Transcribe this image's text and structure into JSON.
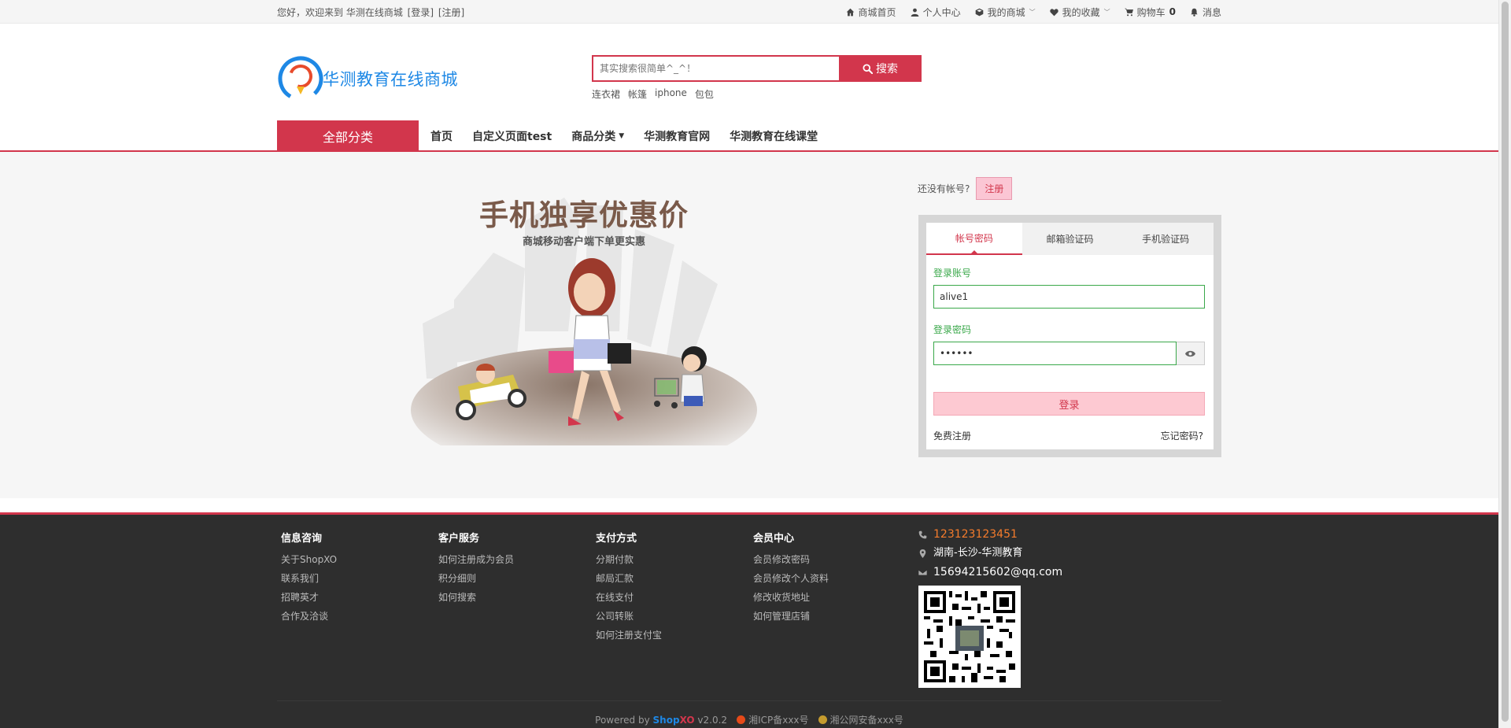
{
  "topbar": {
    "welcome": "您好，欢迎来到 华测在线商城",
    "login": "[登录]",
    "register": "[注册]",
    "nav": [
      {
        "label": "商城首页",
        "icon": "home-icon"
      },
      {
        "label": "个人中心",
        "icon": "user-icon"
      },
      {
        "label": "我的商城",
        "icon": "cube-icon",
        "dropdown": true
      },
      {
        "label": "我的收藏",
        "icon": "heart-icon",
        "dropdown": true
      },
      {
        "label": "购物车",
        "icon": "cart-icon",
        "count": "0"
      },
      {
        "label": "消息",
        "icon": "bell-icon"
      }
    ]
  },
  "header": {
    "logo_text": "华测教育在线商城",
    "search_placeholder": "其实搜索很简单^_^！",
    "search_button": "搜索",
    "hot_words": [
      "连衣裙",
      "帐篷",
      "iphone",
      "包包"
    ]
  },
  "nav": {
    "all_categories": "全部分类",
    "links": [
      "首页",
      "自定义页面test",
      "商品分类",
      "华测教育官网",
      "华测教育在线课堂"
    ]
  },
  "promo": {
    "title": "手机独享优惠价",
    "subtitle": "商城移动客户端下单更实惠"
  },
  "login": {
    "no_account": "还没有帐号?",
    "register_button": "注册",
    "tabs": [
      "帐号密码",
      "邮箱验证码",
      "手机验证码"
    ],
    "active_tab": "帐号密码",
    "account_label": "登录账号",
    "account_value": "alive1",
    "password_label": "登录密码",
    "password_value": "••••••",
    "submit": "登录",
    "free_register": "免费注册",
    "forgot": "忘记密码?"
  },
  "footer": {
    "columns": [
      {
        "title": "信息咨询",
        "links": [
          "关于ShopXO",
          "联系我们",
          "招聘英才",
          "合作及洽谈"
        ]
      },
      {
        "title": "客户服务",
        "links": [
          "如何注册成为会员",
          "积分细则",
          "如何搜索"
        ]
      },
      {
        "title": "支付方式",
        "links": [
          "分期付款",
          "邮局汇款",
          "在线支付",
          "公司转账",
          "如何注册支付宝"
        ]
      },
      {
        "title": "会员中心",
        "links": [
          "会员修改密码",
          "会员修改个人资料",
          "修改收货地址",
          "如何管理店铺"
        ]
      }
    ],
    "phone": "123123123451",
    "address": "湖南-长沙-华测教育",
    "email": "15694215602@qq.com",
    "powered_by": "Powered by",
    "brand_shop": "Shop",
    "brand_xo": "XO",
    "version": "v2.0.2",
    "icp": "湘ICP备xxx号",
    "police": "湘公网安备xxx号"
  },
  "colors": {
    "accent": "#d2364c",
    "logo_blue": "#1e88e5",
    "form_green": "#3aa84a",
    "footer_bg": "#2e2e2e",
    "phone_orange": "#f57c2c"
  }
}
